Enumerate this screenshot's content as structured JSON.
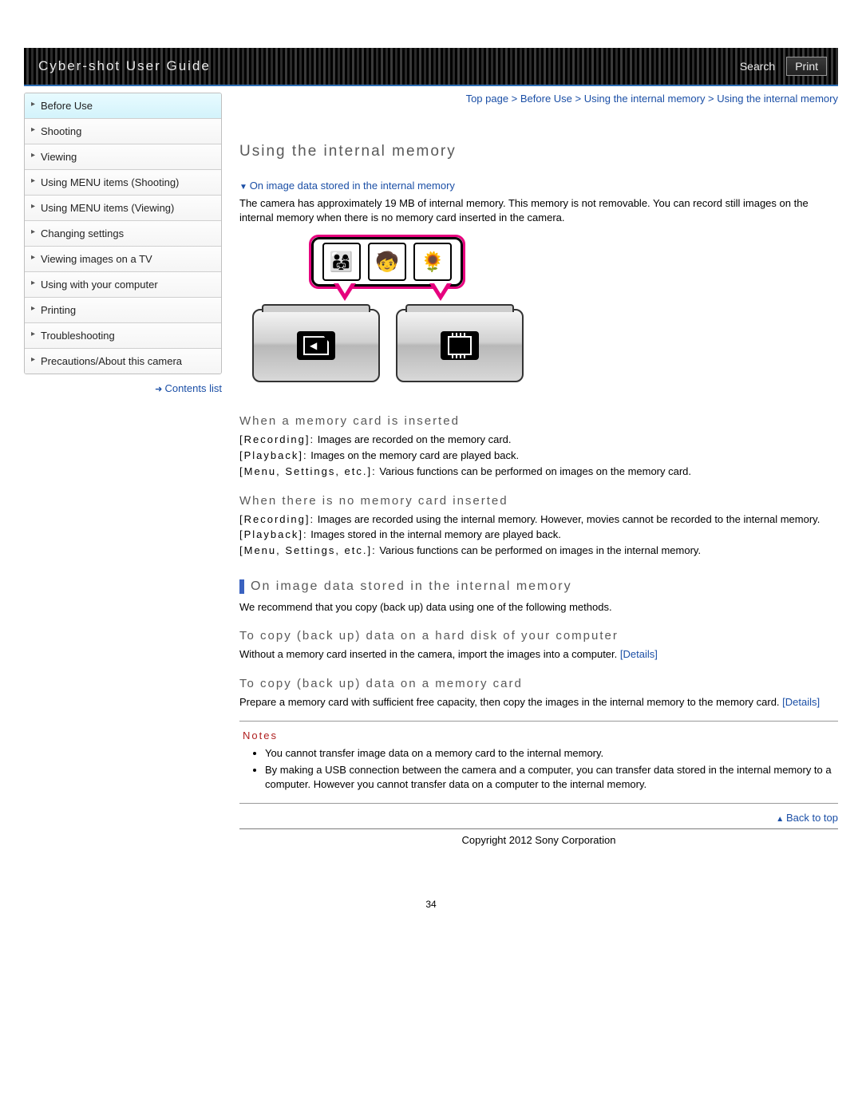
{
  "header": {
    "title": "Cyber-shot User Guide",
    "search": "Search",
    "print": "Print"
  },
  "breadcrumb": "Top page > Before Use > Using the internal memory > Using the internal memory",
  "sidebar": {
    "items": [
      "Before Use",
      "Shooting",
      "Viewing",
      "Using MENU items (Shooting)",
      "Using MENU items (Viewing)",
      "Changing settings",
      "Viewing images on a TV",
      "Using with your computer",
      "Printing",
      "Troubleshooting",
      "Precautions/About this camera"
    ],
    "contents_list": "Contents list"
  },
  "page_title": "Using the internal memory",
  "anchor_link": "On image data stored in the internal memory",
  "intro": "The camera has approximately 19 MB of internal memory. This memory is not removable. You can record still images on the internal memory when there is no memory card inserted in the camera.",
  "sections": {
    "inserted": {
      "heading": "When a memory card is inserted",
      "lines": [
        {
          "k": "[Recording]:",
          "v": " Images are recorded on the memory card."
        },
        {
          "k": "[Playback]:",
          "v": " Images on the memory card are played back."
        },
        {
          "k": "[Menu, Settings, etc.]:",
          "v": " Various functions can be performed on images on the memory card."
        }
      ]
    },
    "not_inserted": {
      "heading": "When there is no memory card inserted",
      "lines": [
        {
          "k": "[Recording]:",
          "v": " Images are recorded using the internal memory. However, movies cannot be recorded to the internal memory."
        },
        {
          "k": "[Playback]:",
          "v": " Images stored in the internal memory are played back."
        },
        {
          "k": "[Menu, Settings, etc.]:",
          "v": " Various functions can be performed on images in the internal memory."
        }
      ]
    },
    "bar_heading": "On image data stored in the internal memory",
    "bar_text": "We recommend that you copy (back up) data using one of the following methods.",
    "copy_hd": {
      "heading": "To copy (back up) data on a hard disk of your computer",
      "text": "Without a memory card inserted in the camera, import the images into a computer. ",
      "link": "[Details]"
    },
    "copy_card": {
      "heading": "To copy (back up) data on a memory card",
      "text": "Prepare a memory card with sufficient free capacity, then copy the images in the internal memory to the memory card. ",
      "link": "[Details]"
    }
  },
  "notes": {
    "title": "Notes",
    "items": [
      "You cannot transfer image data on a memory card to the internal memory.",
      "By making a USB connection between the camera and a computer, you can transfer data stored in the internal memory to a computer. However you cannot transfer data on a computer to the internal memory."
    ]
  },
  "back_top": "Back to top",
  "copyright": "Copyright 2012 Sony Corporation",
  "page_number": "34"
}
